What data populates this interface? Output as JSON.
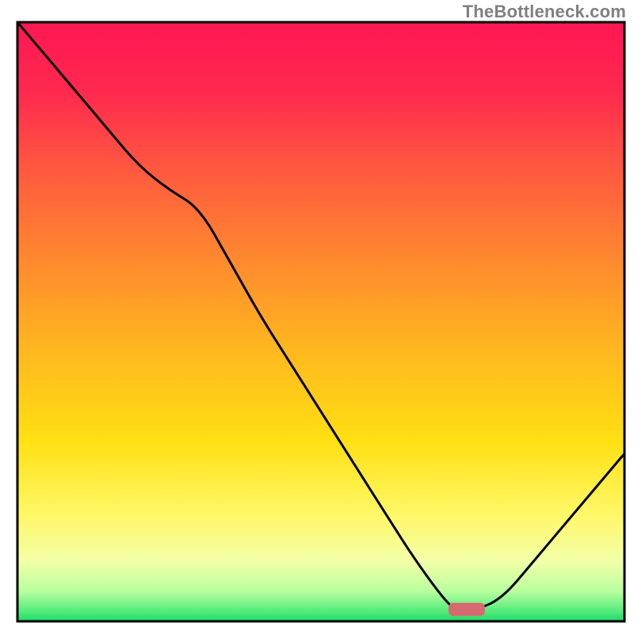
{
  "watermark": "TheBottleneck.com",
  "chart_data": {
    "type": "line",
    "title": "",
    "xlabel": "",
    "ylabel": "",
    "xlim": [
      0,
      100
    ],
    "ylim": [
      0,
      100
    ],
    "x": [
      0,
      5,
      10,
      15,
      20,
      25,
      30,
      35,
      40,
      45,
      50,
      55,
      60,
      65,
      70,
      72,
      76,
      80,
      85,
      90,
      95,
      100
    ],
    "y": [
      100,
      94,
      88,
      82,
      76,
      72,
      69,
      60,
      51,
      43,
      35,
      27,
      19,
      11,
      4,
      2,
      2,
      4,
      10,
      16,
      22,
      28
    ],
    "optimal_marker": {
      "x": 74,
      "y": 2,
      "width": 6,
      "height": 2.2
    },
    "gradient_stops": [
      {
        "offset": 0.0,
        "color": "#ff1753"
      },
      {
        "offset": 0.12,
        "color": "#ff2a4e"
      },
      {
        "offset": 0.25,
        "color": "#ff5a3f"
      },
      {
        "offset": 0.4,
        "color": "#ff8a2e"
      },
      {
        "offset": 0.55,
        "color": "#ffb81f"
      },
      {
        "offset": 0.7,
        "color": "#ffe012"
      },
      {
        "offset": 0.82,
        "color": "#fff766"
      },
      {
        "offset": 0.9,
        "color": "#f3ffa8"
      },
      {
        "offset": 0.95,
        "color": "#b8ff9e"
      },
      {
        "offset": 0.985,
        "color": "#4eea7a"
      },
      {
        "offset": 1.0,
        "color": "#1fd969"
      }
    ],
    "line_color": "#000000",
    "marker_color": "#d66a6f",
    "border_color": "#000000"
  }
}
